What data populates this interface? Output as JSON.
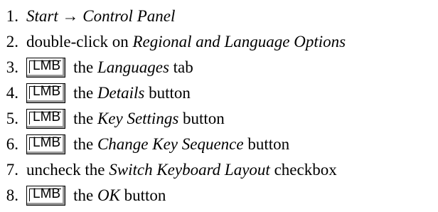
{
  "steps": [
    {
      "number": "1.",
      "parts": [
        {
          "text": "Start → Control Panel",
          "style": "italic"
        }
      ]
    },
    {
      "number": "2.",
      "parts": [
        {
          "text": "double-click on ",
          "style": "normal"
        },
        {
          "text": "Regional and Language Options",
          "style": "italic"
        }
      ]
    },
    {
      "number": "3.",
      "parts": [
        {
          "text": "LMB",
          "style": "key"
        },
        {
          "text": "the ",
          "style": "normal"
        },
        {
          "text": "Languages",
          "style": "italic"
        },
        {
          "text": " tab",
          "style": "normal"
        }
      ]
    },
    {
      "number": "4.",
      "parts": [
        {
          "text": "LMB",
          "style": "key"
        },
        {
          "text": "the ",
          "style": "normal"
        },
        {
          "text": "Details",
          "style": "italic"
        },
        {
          "text": " button",
          "style": "normal"
        }
      ]
    },
    {
      "number": "5.",
      "parts": [
        {
          "text": "LMB",
          "style": "key"
        },
        {
          "text": "the ",
          "style": "normal"
        },
        {
          "text": "Key Settings",
          "style": "italic"
        },
        {
          "text": " button",
          "style": "normal"
        }
      ]
    },
    {
      "number": "6.",
      "parts": [
        {
          "text": "LMB",
          "style": "key"
        },
        {
          "text": "the ",
          "style": "normal"
        },
        {
          "text": "Change Key Sequence",
          "style": "italic"
        },
        {
          "text": " button",
          "style": "normal"
        }
      ]
    },
    {
      "number": "7.",
      "parts": [
        {
          "text": "uncheck the ",
          "style": "normal"
        },
        {
          "text": "Switch Keyboard Layout",
          "style": "italic"
        },
        {
          "text": " checkbox",
          "style": "normal"
        }
      ]
    },
    {
      "number": "8.",
      "parts": [
        {
          "text": "LMB",
          "style": "key"
        },
        {
          "text": "the ",
          "style": "normal"
        },
        {
          "text": "OK",
          "style": "italic"
        },
        {
          "text": " button",
          "style": "normal"
        }
      ]
    }
  ]
}
